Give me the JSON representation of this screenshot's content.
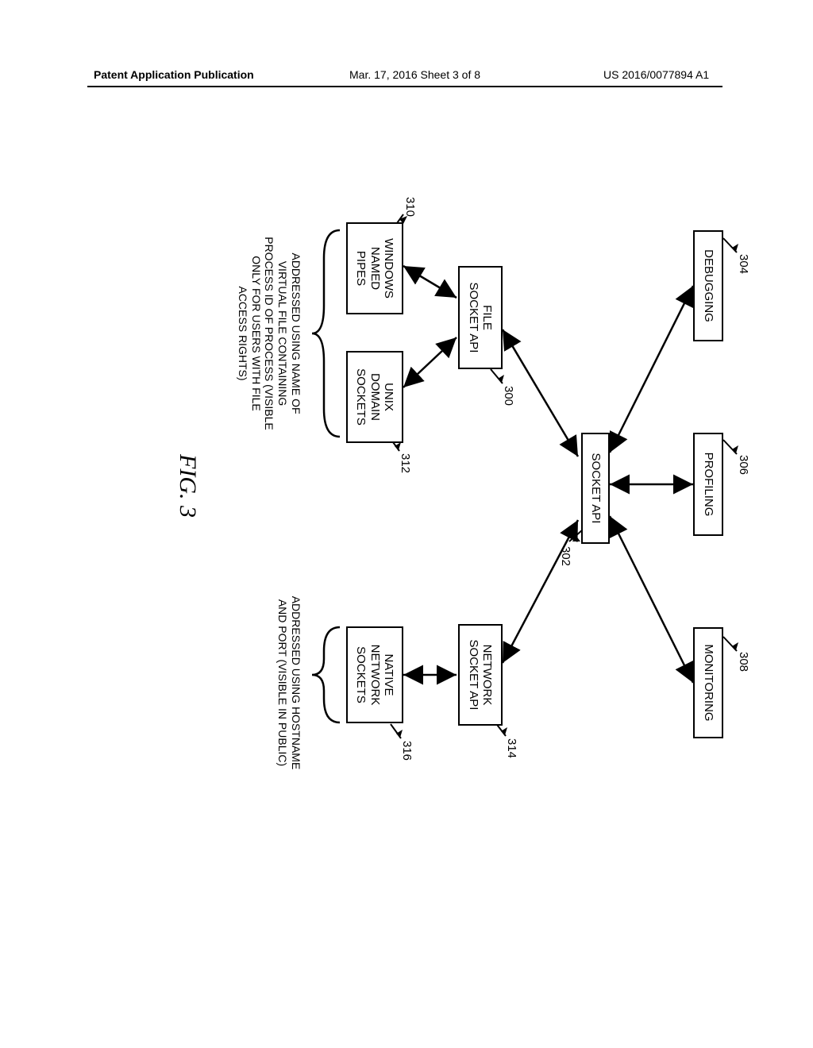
{
  "header": {
    "left": "Patent Application Publication",
    "middle": "Mar. 17, 2016  Sheet 3 of 8",
    "right": "US 2016/0077894 A1"
  },
  "boxes": {
    "debugging": "DEBUGGING",
    "profiling": "PROFILING",
    "monitoring": "MONITORING",
    "socket_api": "SOCKET API",
    "file_socket_api": "FILE\nSOCKET API",
    "network_socket_api": "NETWORK\nSOCKET API",
    "windows_named_pipes": "WINDOWS\nNAMED\nPIPES",
    "unix_domain_sockets": "UNIX\nDOMAIN\nSOCKETS",
    "native_network_sockets": "NATIVE\nNETWORK\nSOCKETS"
  },
  "refs": {
    "r304": "304",
    "r306": "306",
    "r308": "308",
    "r302": "302",
    "r300": "300",
    "r314": "314",
    "r310": "310",
    "r312": "312",
    "r316": "316"
  },
  "labels": {
    "left_group": "ADDRESSED USING NAME OF\nVIRTUAL FILE CONTAINING\nPROCESS ID OF PROCESS (VISIBLE\nONLY FOR USERS WITH FILE\nACCESS RIGHTS)",
    "right_group": "ADDRESSED USING HOSTNAME\nAND PORT (VISIBLE IN PUBLIC)"
  },
  "figure": "FIG. 3"
}
